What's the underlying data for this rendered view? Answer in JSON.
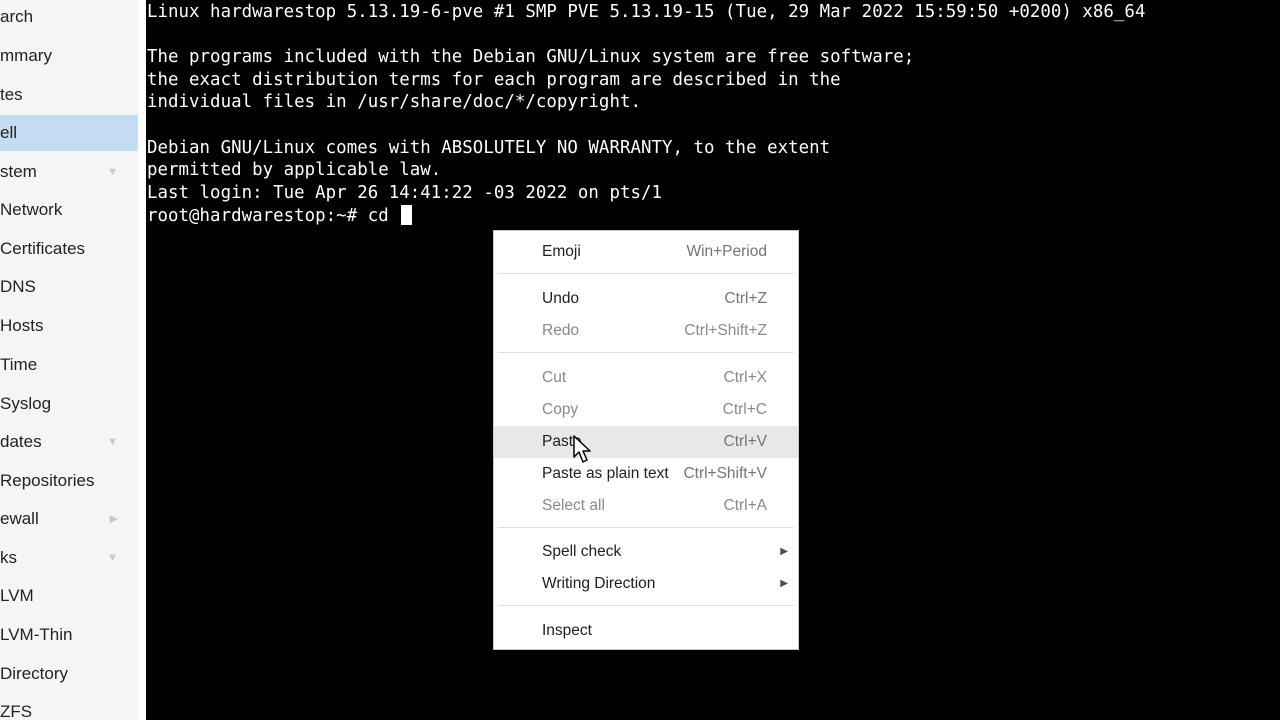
{
  "sidebar": {
    "items": [
      {
        "label": "arch",
        "active": false,
        "arrow": ""
      },
      {
        "label": "mmary",
        "active": false,
        "arrow": ""
      },
      {
        "label": "tes",
        "active": false,
        "arrow": ""
      },
      {
        "label": "ell",
        "active": true,
        "arrow": ""
      },
      {
        "label": "stem",
        "active": false,
        "arrow": "▼"
      },
      {
        "label": "Network",
        "active": false,
        "arrow": ""
      },
      {
        "label": "Certificates",
        "active": false,
        "arrow": ""
      },
      {
        "label": "DNS",
        "active": false,
        "arrow": ""
      },
      {
        "label": "Hosts",
        "active": false,
        "arrow": ""
      },
      {
        "label": "Time",
        "active": false,
        "arrow": ""
      },
      {
        "label": "Syslog",
        "active": false,
        "arrow": ""
      },
      {
        "label": "dates",
        "active": false,
        "arrow": "▼"
      },
      {
        "label": "Repositories",
        "active": false,
        "arrow": ""
      },
      {
        "label": "ewall",
        "active": false,
        "arrow": "▶"
      },
      {
        "label": "ks",
        "active": false,
        "arrow": "▼"
      },
      {
        "label": "LVM",
        "active": false,
        "arrow": ""
      },
      {
        "label": "LVM-Thin",
        "active": false,
        "arrow": ""
      },
      {
        "label": "Directory",
        "active": false,
        "arrow": ""
      },
      {
        "label": "ZFS",
        "active": false,
        "arrow": ""
      }
    ]
  },
  "terminal": {
    "lines": [
      "Linux hardwarestop 5.13.19-6-pve #1 SMP PVE 5.13.19-15 (Tue, 29 Mar 2022 15:59:50 +0200) x86_64",
      "",
      "The programs included with the Debian GNU/Linux system are free software;",
      "the exact distribution terms for each program are described in the",
      "individual files in /usr/share/doc/*/copyright.",
      "",
      "Debian GNU/Linux comes with ABSOLUTELY NO WARRANTY, to the extent",
      "permitted by applicable law.",
      "Last login: Tue Apr 26 14:41:22 -03 2022 on pts/1"
    ],
    "prompt": "root@hardwarestop:~# cd "
  },
  "context_menu": {
    "items": [
      {
        "label": "Emoji",
        "shortcut": "Win+Period",
        "disabled": false
      },
      {
        "label": "Undo",
        "shortcut": "Ctrl+Z",
        "disabled": false
      },
      {
        "label": "Redo",
        "shortcut": "Ctrl+Shift+Z",
        "disabled": true
      },
      {
        "label": "Cut",
        "shortcut": "Ctrl+X",
        "disabled": true
      },
      {
        "label": "Copy",
        "shortcut": "Ctrl+C",
        "disabled": true
      },
      {
        "label": "Paste",
        "shortcut": "Ctrl+V",
        "disabled": false
      },
      {
        "label": "Paste as plain text",
        "shortcut": "Ctrl+Shift+V",
        "disabled": false
      },
      {
        "label": "Select all",
        "shortcut": "Ctrl+A",
        "disabled": true
      },
      {
        "label": "Spell check",
        "shortcut": "",
        "disabled": false
      },
      {
        "label": "Writing Direction",
        "shortcut": "",
        "disabled": false
      },
      {
        "label": "Inspect",
        "shortcut": "",
        "disabled": false
      }
    ]
  },
  "icons": {
    "submenu": "chevron-right-icon",
    "collapse": "chevron-down-icon",
    "expand": "chevron-right-icon",
    "pointer": "mouse-pointer-icon"
  },
  "colors": {
    "terminal_bg": "#000000",
    "terminal_fg": "#ffffff",
    "sidebar_active": "#c4dcf2",
    "menu_hover": "#e8e8e8"
  }
}
